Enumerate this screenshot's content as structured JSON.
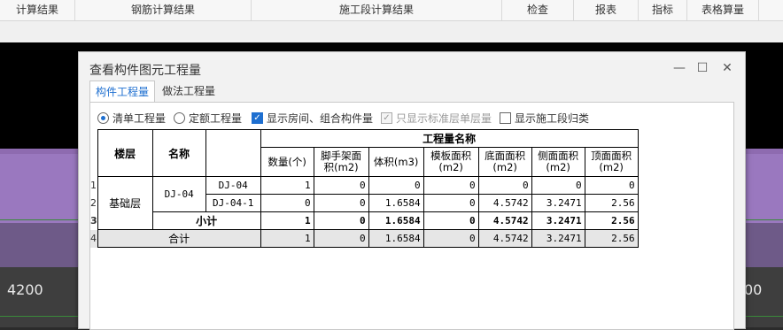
{
  "topbar": {
    "items": [
      "计算结果",
      "钢筋计算结果",
      "施工段计算结果",
      "检查",
      "报表",
      "指标",
      "表格算量"
    ]
  },
  "viewport": {
    "axis_left": "4200",
    "axis_right": "00"
  },
  "dialog": {
    "title": "查看构件图元工程量",
    "minimize": "—",
    "maximize": "☐",
    "close": "✕",
    "tabs": [
      "构件工程量",
      "做法工程量"
    ],
    "options": {
      "radio_list": "清单工程量",
      "radio_quota": "定额工程量",
      "chk_rooms": "显示房间、组合构件量",
      "chk_std_floor": "只显示标准层单层量",
      "chk_section": "显示施工段归类"
    },
    "table": {
      "col_floor": "楼层",
      "col_name": "名称",
      "group_header": "工程量名称",
      "columns": [
        "数量(个)",
        "脚手架面积(m2)",
        "体积(m3)",
        "模板面积(m2)",
        "底面面积(m2)",
        "侧面面积(m2)",
        "顶面面积(m2)"
      ],
      "row_numbers": [
        "1",
        "2",
        "3",
        "4"
      ],
      "floor": "基础层",
      "name": "DJ-04",
      "rows": [
        {
          "sub": "DJ-04",
          "values": [
            "1",
            "0",
            "0",
            "0",
            "0",
            "0",
            "0"
          ]
        },
        {
          "sub": "DJ-04-1",
          "values": [
            "0",
            "0",
            "1.6584",
            "0",
            "4.5742",
            "3.2471",
            "2.56"
          ]
        }
      ],
      "subtotal": {
        "label": "小计",
        "values": [
          "1",
          "0",
          "1.6584",
          "0",
          "4.5742",
          "3.2471",
          "2.56"
        ]
      },
      "total": {
        "label": "合计",
        "values": [
          "1",
          "0",
          "1.6584",
          "0",
          "4.5742",
          "3.2471",
          "2.56"
        ]
      }
    }
  }
}
